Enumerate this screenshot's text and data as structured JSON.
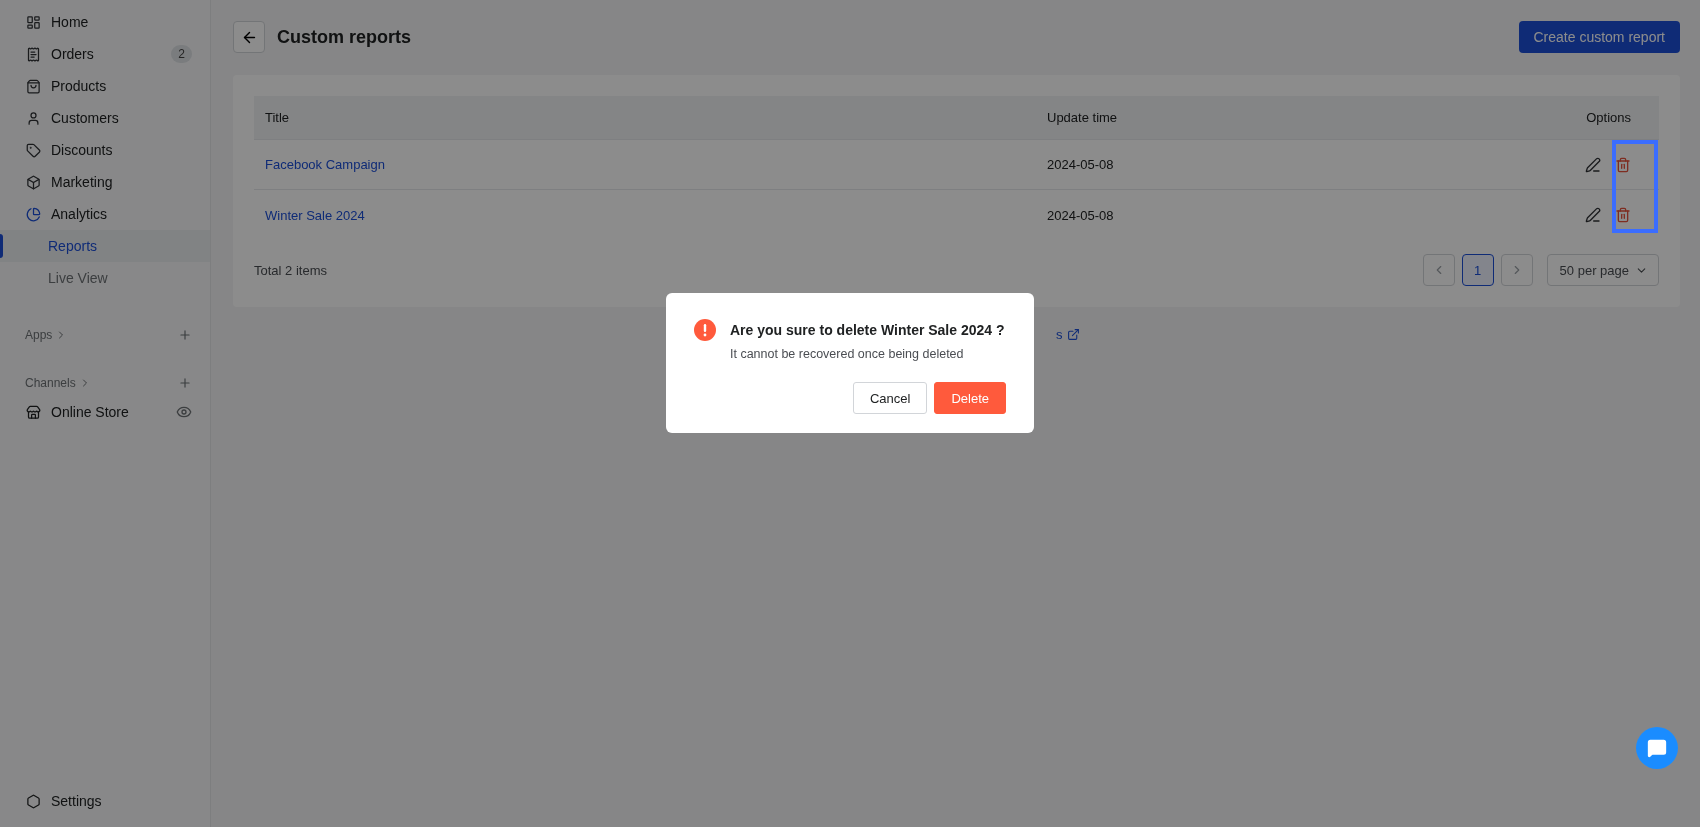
{
  "sidebar": {
    "items": [
      {
        "label": "Home",
        "selected": false
      },
      {
        "label": "Orders",
        "badge": "2",
        "selected": false
      },
      {
        "label": "Products",
        "selected": false
      },
      {
        "label": "Customers",
        "selected": false
      },
      {
        "label": "Discounts",
        "selected": false
      },
      {
        "label": "Marketing",
        "selected": false
      },
      {
        "label": "Analytics",
        "selected": false,
        "children": [
          {
            "label": "Reports",
            "selected": true
          },
          {
            "label": "Live View",
            "selected": false
          }
        ]
      }
    ],
    "sections": [
      {
        "label": "Apps"
      },
      {
        "label": "Channels",
        "items": [
          {
            "label": "Online Store"
          }
        ]
      }
    ],
    "settings": "Settings"
  },
  "header": {
    "title": "Custom reports",
    "primary_button": "Create custom report"
  },
  "table": {
    "columns": [
      "Title",
      "Update time",
      "Options"
    ],
    "rows": [
      {
        "title": "Facebook Campaign",
        "update_time": "2024-05-08"
      },
      {
        "title": "Winter Sale 2024",
        "update_time": "2024-05-08"
      }
    ],
    "options_highlighted": true,
    "total": "Total 2 items",
    "pagination": {
      "pages": [
        {
          "label": "1",
          "selected": true
        }
      ],
      "page_size": "50 per page"
    }
  },
  "footer_link": "s",
  "dialog": {
    "title": "Are you sure to delete Winter Sale 2024 ?",
    "message": "It cannot be recovered once being deleted",
    "buttons": [
      {
        "label": "Cancel",
        "kind": "secondary"
      },
      {
        "label": "Delete",
        "kind": "danger"
      }
    ]
  }
}
